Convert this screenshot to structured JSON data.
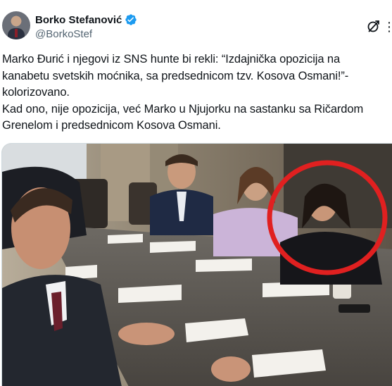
{
  "author": {
    "display_name": "Borko Stefanović",
    "handle": "@BorkoStef",
    "verified": true,
    "avatar_icon": "profile-photo"
  },
  "actions": {
    "grok_icon": "grok-icon",
    "more_icon": "more-icon"
  },
  "post": {
    "text": "Marko Đurić i njegovi iz SNS hunte bi rekli: “Izdajnička opozicija na kanabetu svetskih moćnika, sa predsednicom tzv. Kosova Osmani!”-kolorizovano.\nKad ono, nije opozicija, već Marko u Njujorku na sastanku sa Ričardom Grenelom i predsednicom Kosova Osmani."
  },
  "media": {
    "type": "photo",
    "highlight_color": "#e02020"
  },
  "colors": {
    "verified": "#1d9bf0",
    "text": "#0f1419",
    "secondary": "#536471"
  }
}
